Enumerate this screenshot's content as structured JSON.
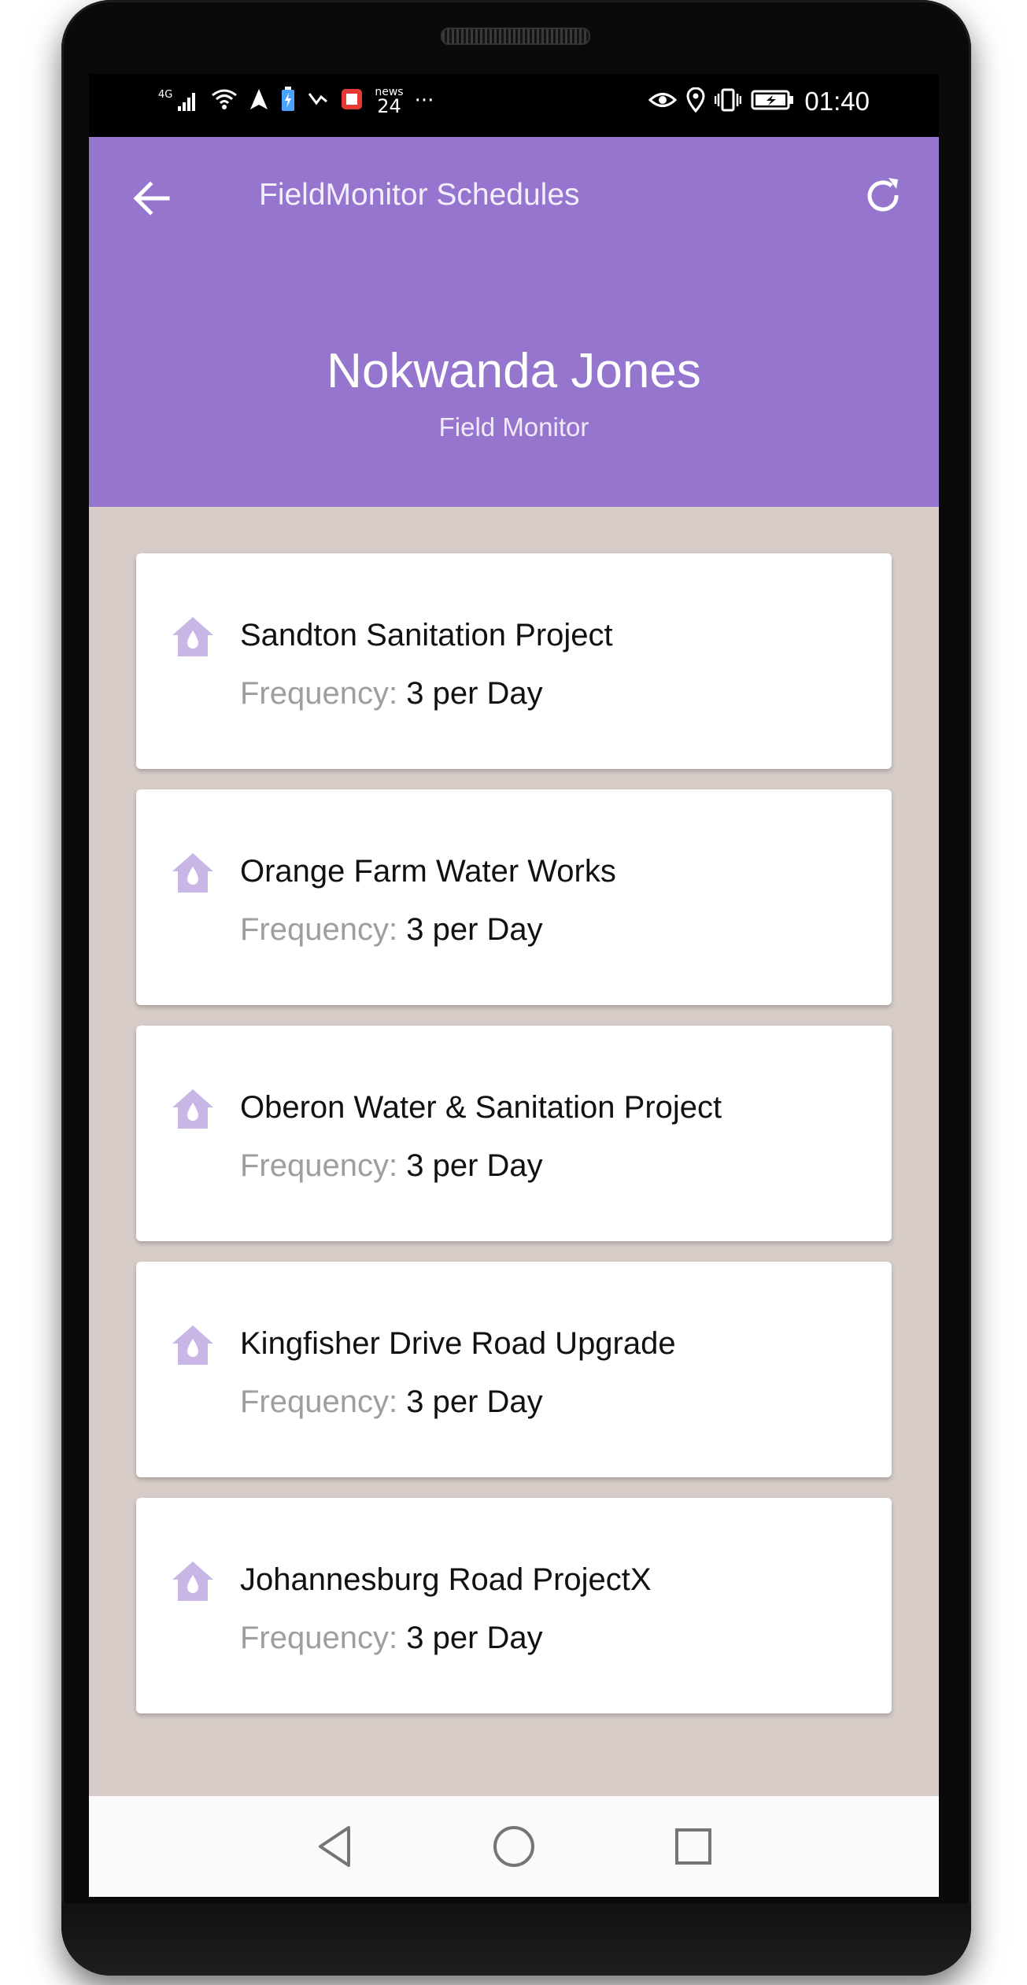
{
  "status_bar": {
    "network": "4G",
    "news_label": "news",
    "news_number": "24",
    "more": "···",
    "time": "01:40"
  },
  "app_bar": {
    "title": "FieldMonitor Schedules",
    "back_icon": "arrow-left-icon",
    "refresh_icon": "refresh-icon",
    "color": "#9575cd"
  },
  "profile": {
    "name": "Nokwanda Jones",
    "role": "Field Monitor"
  },
  "schedules": [
    {
      "title": "Sandton Sanitation Project",
      "frequency_label": "Frequency:",
      "frequency_value": "3 per Day"
    },
    {
      "title": "Orange Farm Water Works",
      "frequency_label": "Frequency:",
      "frequency_value": "3 per Day"
    },
    {
      "title": "Oberon Water & Sanitation Project",
      "frequency_label": "Frequency:",
      "frequency_value": "3 per Day"
    },
    {
      "title": "Kingfisher Drive Road Upgrade",
      "frequency_label": "Frequency:",
      "frequency_value": "3 per Day"
    },
    {
      "title": "Johannesburg Road ProjectX",
      "frequency_label": "Frequency:",
      "frequency_value": "3 per Day"
    }
  ],
  "schedule_icon": "water-house-icon",
  "colors": {
    "accent": "#9575cd",
    "list_background": "#d7ccc8",
    "icon": "#c8b6e6"
  },
  "nav_bar": {
    "back_icon": "nav-back-icon",
    "home_icon": "nav-home-icon",
    "recents_icon": "nav-recents-icon"
  }
}
